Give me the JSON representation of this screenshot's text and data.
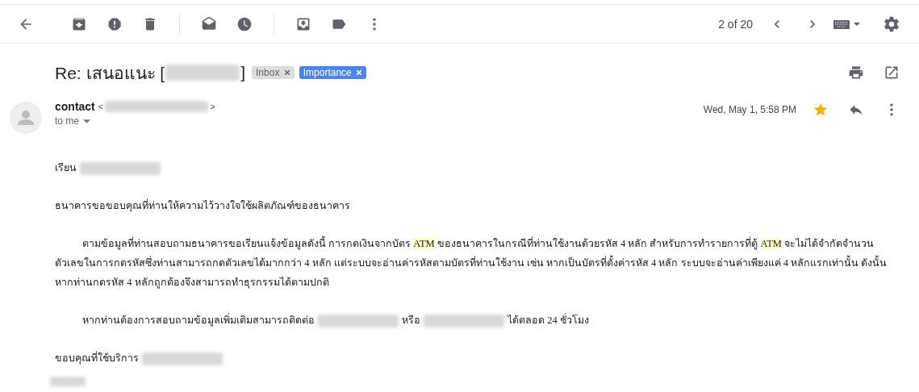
{
  "toolbar": {
    "pagination": "2 of 20"
  },
  "subject": {
    "prefix": "Re: เสนอแนะ [",
    "suffix": "]",
    "labels": [
      {
        "text": "Inbox",
        "color": "#dddddd"
      },
      {
        "text": "Importance",
        "color": "#4a86e8"
      }
    ]
  },
  "message": {
    "sender": "contact",
    "open_bracket": "<",
    "close_bracket": ">",
    "recipient": "to me",
    "date": "Wed, May 1, 5:58 PM",
    "starred": true
  },
  "body": {
    "paragraphs": [
      {
        "indent": false,
        "segments": [
          {
            "kind": "text",
            "text": "เรียน"
          },
          {
            "kind": "redaction"
          }
        ]
      },
      {
        "indent": false,
        "segments": [
          {
            "kind": "text",
            "text": "ธนาคารขอขอบคุณที่ท่านให้ความไว้วางใจใช้ผลิตภัณฑ์ของธนาคาร"
          }
        ]
      },
      {
        "indent": true,
        "segments": [
          {
            "kind": "text",
            "text": "ตามข้อมูลที่ท่านสอบถามธนาคารขอเรียนแจ้งข้อมูลดังนี้ การกดเงินจากบัตร "
          },
          {
            "kind": "highlight",
            "text": "ATM"
          },
          {
            "kind": "text",
            "text": " ของธนาคารในกรณีที่ท่านใช้งานด้วยรหัส 4 หลัก สำหรับการทำรายการที่ตู้ "
          },
          {
            "kind": "highlight",
            "text": "ATM"
          },
          {
            "kind": "text",
            "text": " จะไม่ได้จำกัดจำนวนตัวเลขในการกดรหัสซึ่งท่านสามารถกดตัวเลขได้มากกว่า 4 หลัก แต่ระบบจะอ่านค่ารหัสตามบัตรที่ท่านใช้งาน เช่น หากเป็นบัตรที่ตั้งค่ารหัส 4 หลัก ระบบจะอ่านค่าเพียงแค่ 4 หลักแรกเท่านั้น ดังนั้นหากท่านกดรหัส 4 หลักถูกต้องจึงสามารถทำธุรกรรมได้ตามปกติ"
          }
        ]
      },
      {
        "indent": true,
        "segments": [
          {
            "kind": "text",
            "text": "หากท่านต้องการสอบถามข้อมูลเพิ่มเติมสามารถติดต่อ"
          },
          {
            "kind": "redaction"
          },
          {
            "kind": "text",
            "text": "หรือ"
          },
          {
            "kind": "redaction"
          },
          {
            "kind": "text",
            "text": "ได้ตลอด 24 ชั่วโมง"
          }
        ]
      },
      {
        "indent": false,
        "segments": [
          {
            "kind": "text",
            "text": "ขอบคุณที่ใช้บริการ"
          },
          {
            "kind": "redaction"
          }
        ]
      }
    ]
  }
}
